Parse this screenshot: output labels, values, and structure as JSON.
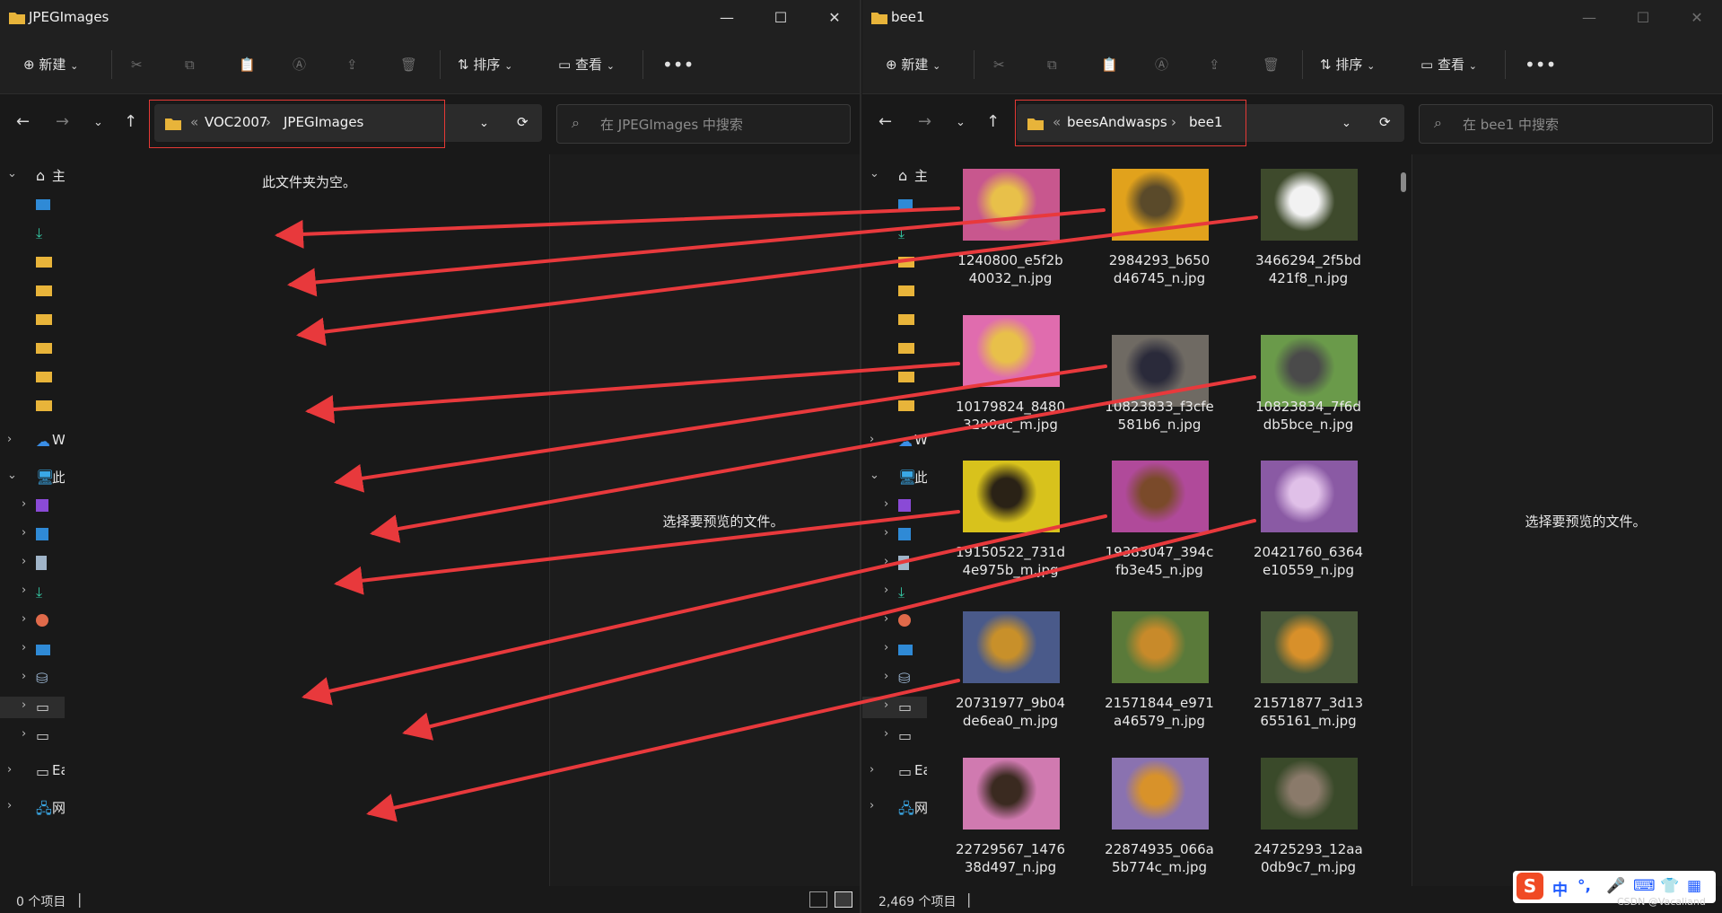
{
  "left": {
    "window_title": "JPEGImages",
    "toolbar": {
      "new_label": "新建",
      "sort_label": "排序",
      "view_label": "查看"
    },
    "breadcrumb": [
      "VOC2007",
      "JPEGImages"
    ],
    "breadcrumb_prefix": "«",
    "search_placeholder": "在 JPEGImages 中搜索",
    "empty_message": "此文件夹为空。",
    "preview_message": "选择要预览的文件。",
    "status": "0 个项目"
  },
  "right": {
    "window_title": "bee1",
    "toolbar": {
      "new_label": "新建",
      "sort_label": "排序",
      "view_label": "查看"
    },
    "breadcrumb": [
      "beesAndwasps",
      "bee1"
    ],
    "breadcrumb_prefix": "«",
    "search_placeholder": "在 bee1 中搜索",
    "preview_message": "选择要预览的文件。",
    "status": "2,469 个项目",
    "files": [
      {
        "line1": "1240800_e5f2b",
        "line2": "40032_n.jpg",
        "bg": "#c8578e",
        "fg": "#e8c04a"
      },
      {
        "line1": "2984293_b650",
        "line2": "d46745_n.jpg",
        "bg": "#e1a21c",
        "fg": "#5a4a2a"
      },
      {
        "line1": "3466294_2f5bd",
        "line2": "421f8_n.jpg",
        "bg": "#3e4a2c",
        "fg": "#f2f2f2"
      },
      {
        "line1": "10179824_8480",
        "line2": "3290ac_m.jpg",
        "bg": "#e06cae",
        "fg": "#e8c04a"
      },
      {
        "line1": "10823833_f3cfe",
        "line2": "581b6_n.jpg",
        "bg": "#6f6a63",
        "fg": "#2a2a3a"
      },
      {
        "line1": "10823834_7f6d",
        "line2": "db5bce_n.jpg",
        "bg": "#6a9a4a",
        "fg": "#4a4a4a"
      },
      {
        "line1": "19150522_731d",
        "line2": "4e975b_m.jpg",
        "bg": "#d8c21c",
        "fg": "#2a2216"
      },
      {
        "line1": "19383047_394c",
        "line2": "fb3e45_n.jpg",
        "bg": "#b04a9a",
        "fg": "#7a4a2a"
      },
      {
        "line1": "20421760_6364",
        "line2": "e10559_n.jpg",
        "bg": "#8a5aa4",
        "fg": "#e0c0e8"
      },
      {
        "line1": "20731977_9b04",
        "line2": "de6ea0_m.jpg",
        "bg": "#4a5a8a",
        "fg": "#c8902a"
      },
      {
        "line1": "21571844_e971",
        "line2": "a46579_n.jpg",
        "bg": "#5a7a3a",
        "fg": "#c88a2a"
      },
      {
        "line1": "21571877_3d13",
        "line2": "655161_m.jpg",
        "bg": "#4a5a3a",
        "fg": "#d8902a"
      },
      {
        "line1": "22729567_1476",
        "line2": "38d497_n.jpg",
        "bg": "#d07ab0",
        "fg": "#3a2a20"
      },
      {
        "line1": "22874935_066a",
        "line2": "5b774c_m.jpg",
        "bg": "#8a72b0",
        "fg": "#d8922a"
      },
      {
        "line1": "24725293_12aa",
        "line2": "0db9c7_m.jpg",
        "bg": "#3a4a2a",
        "fg": "#8a7a6a"
      }
    ]
  },
  "ime": {
    "logo": "S",
    "lang": "中",
    "punct": "°,",
    "mic": "🎤",
    "keyboard": "⌨",
    "shirt": "👕",
    "apps": "▦"
  },
  "watermark": "CSDN @Vacaliand",
  "colors": {
    "arrow": "#e8393c",
    "redbox": "#e53935",
    "bg": "#191919",
    "chrome": "#202020"
  }
}
